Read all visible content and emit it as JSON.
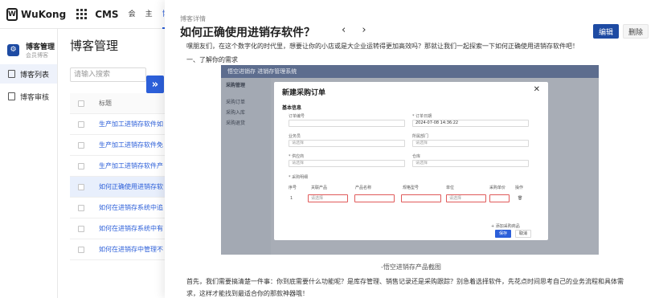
{
  "topbar": {
    "logo_text": "WuKong",
    "cms_label": "CMS",
    "nav": [
      "会员",
      "主题",
      "博客"
    ],
    "active_nav": "博客"
  },
  "sidebar": {
    "title": "博客管理",
    "subtitle": "会员博客",
    "items": [
      {
        "label": "博客列表",
        "active": true
      },
      {
        "label": "博客审核",
        "active": false
      }
    ]
  },
  "main": {
    "title": "博客管理",
    "search_placeholder": "请输入搜索",
    "column_title": "标题",
    "rows": [
      {
        "title": "生产加工进销存软件如",
        "selected": false
      },
      {
        "title": "生产加工进销存软件免",
        "selected": false
      },
      {
        "title": "生产加工进销存软件产",
        "selected": false
      },
      {
        "title": "如何正确使用进销存软",
        "selected": true
      },
      {
        "title": "如何在进销存系统中追",
        "selected": false
      },
      {
        "title": "如何在进销存系统中有",
        "selected": false
      },
      {
        "title": "如何在进销存中管理不",
        "selected": false
      }
    ]
  },
  "panel": {
    "label": "博客详情",
    "title": "如何正确使用进销存软件？",
    "edit_label": "编辑",
    "delete_label": "删除",
    "intro": "嘿朋友们，在这个数字化的时代里，想要让你的小店或是大企业运转得更加高效吗？那就让我们一起探索一下如何正确使用进销存软件吧！",
    "section1": "一、了解你的需求",
    "caption": "-悟空进销存产品截图",
    "body1": "首先，我们需要搞清楚一件事：你到底需要什么功能呢？是库存管理、销售记录还是采购跟踪？别急着选择软件，先花点时间思考自己的业务流程和具体需",
    "body2": "求，这样才能找到最适合你的那款神器哦！"
  },
  "screenshot": {
    "app_title": "悟空进销存",
    "top_title": "进销存管理系统",
    "side_title": "采购管理",
    "side_items": [
      "采购订单",
      "采购入库",
      "采购退货"
    ],
    "modal": {
      "title": "新建采购订单",
      "section": "基本信息",
      "fields": [
        {
          "label": "订单编号",
          "value": "",
          "placeholder": ""
        },
        {
          "label": "* 订单日期",
          "value": "2024-07-08 14:36:22",
          "placeholder": ""
        },
        {
          "label": "业务员",
          "value": "",
          "placeholder": "请选择"
        },
        {
          "label": "所属部门",
          "value": "",
          "placeholder": "请选择"
        },
        {
          "label": "* 供应商",
          "value": "",
          "placeholder": "请选择"
        },
        {
          "label": "仓库",
          "value": "",
          "placeholder": "请选择"
        }
      ],
      "detail_label": "* 采购明细",
      "columns": [
        "序号",
        "关联产品",
        "产品名称",
        "规格型号",
        "单位",
        "采购单价",
        "操作"
      ],
      "row_index": "1",
      "cell_placeholder": "请选择",
      "add_label": "+ 添加采购商品",
      "save_label": "保存",
      "cancel_label": "取消"
    }
  },
  "colors": {
    "accent": "#2c5fd9",
    "edit_button": "#1e4ba3",
    "link": "#2c5fd9"
  }
}
